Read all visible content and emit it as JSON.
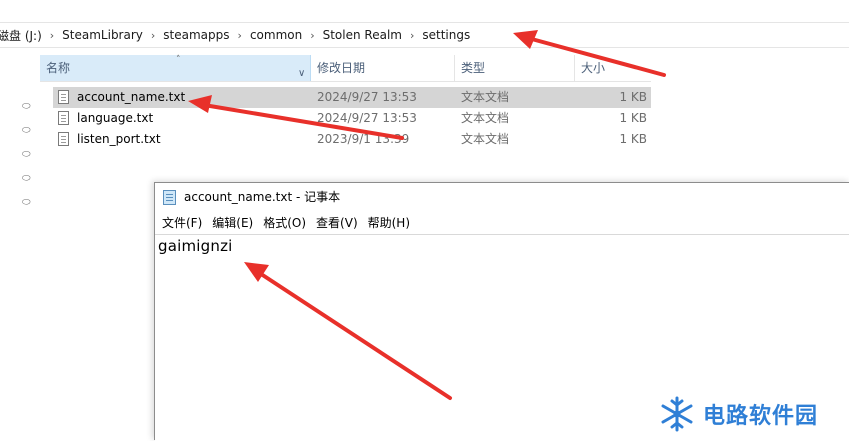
{
  "explorer": {
    "breadcrumb": [
      "磁盘 (J:)",
      "SteamLibrary",
      "steamapps",
      "common",
      "Stolen Realm",
      "settings"
    ],
    "columns": {
      "name": "名称",
      "date": "修改日期",
      "type": "类型",
      "size": "大小"
    },
    "files": [
      {
        "name": "account_name.txt",
        "date": "2024/9/27 13:53",
        "type": "文本文档",
        "size": "1 KB",
        "selected": true
      },
      {
        "name": "language.txt",
        "date": "2024/9/27 13:53",
        "type": "文本文档",
        "size": "1 KB",
        "selected": false
      },
      {
        "name": "listen_port.txt",
        "date": "2023/9/1 13:39",
        "type": "文本文档",
        "size": "1 KB",
        "selected": false
      }
    ]
  },
  "notepad": {
    "title": "account_name.txt - 记事本",
    "menu": [
      "文件(F)",
      "编辑(E)",
      "格式(O)",
      "查看(V)",
      "帮助(H)"
    ],
    "content": "gaimignzi"
  },
  "watermark": {
    "text": "电路软件园",
    "icon": "snowflake-logo-icon"
  },
  "colors": {
    "accent": "#2f7fd6",
    "arrow": "#e8302a",
    "selection": "#d5d5d5",
    "header_active": "#d9ebf9"
  }
}
